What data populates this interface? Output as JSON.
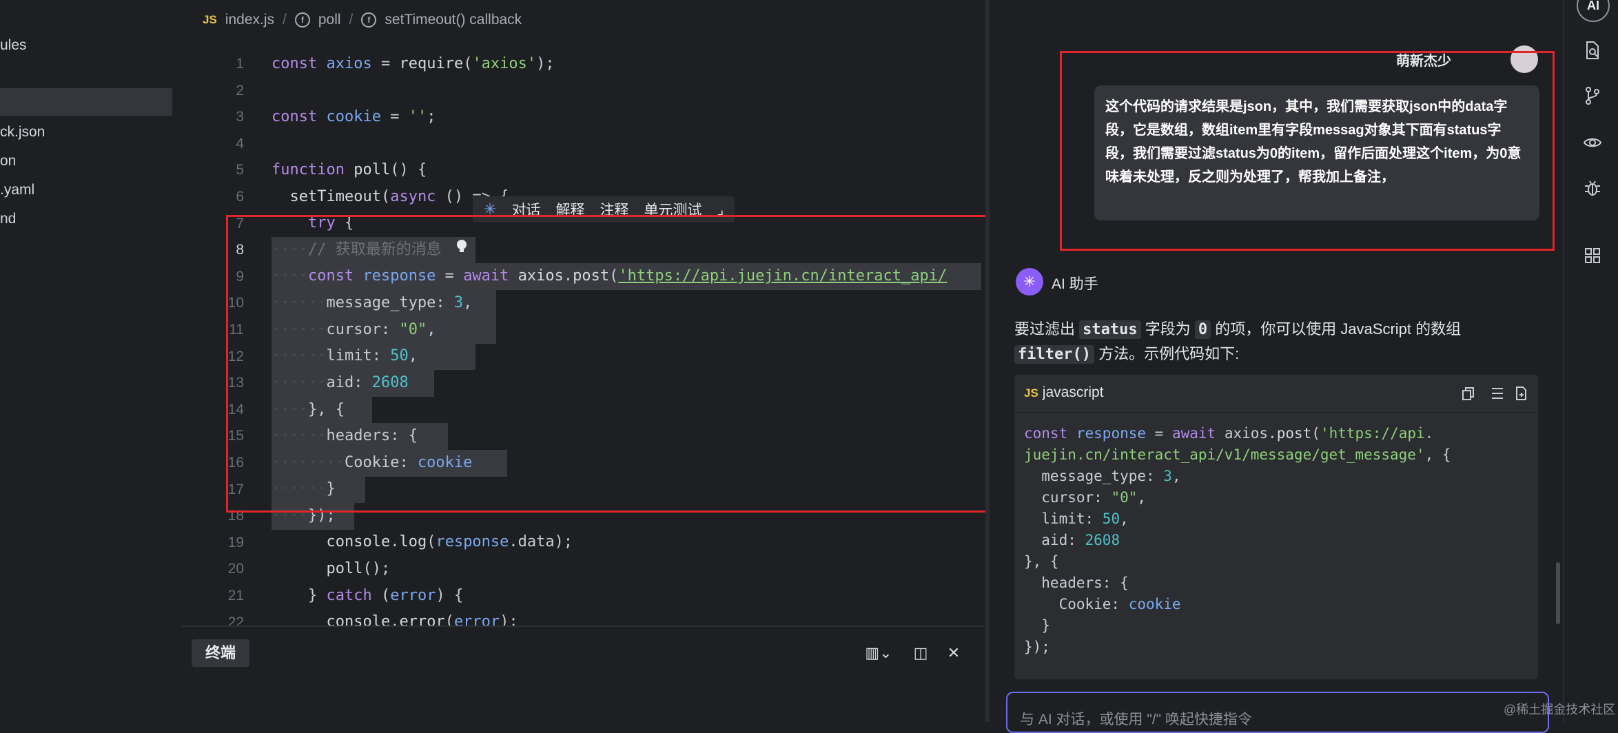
{
  "explorer": {
    "items": [
      "ules",
      "",
      "ck.json",
      "on",
      ".yaml",
      "nd"
    ]
  },
  "editor": {
    "breadcrumb": {
      "file_badge": "JS",
      "file": "index.js",
      "fn1": "poll",
      "fn2": "setTimeout() callback"
    },
    "line_numbers": [
      "1",
      "2",
      "3",
      "4",
      "5",
      "6",
      "7",
      "8",
      "9",
      "10",
      "11",
      "12",
      "13",
      "14",
      "15",
      "16",
      "17",
      "18",
      "19",
      "20",
      "21",
      "22"
    ],
    "inline_menu": [
      "对话",
      "解释",
      "注释",
      "单元测试"
    ],
    "comment": "// 获取最新的消息",
    "url": "'https://api.juejin.cn/interact_api/"
  },
  "terminal": {
    "tab_label": "终端"
  },
  "ai_panel": {
    "user_name": "萌新杰少",
    "user_message": "这个代码的请求结果是json，其中，我们需要获取json中的data字段，它是数组，数组item里有字段messag对象其下面有status字段，我们需要过滤status为0的item，留作后面处理这个item，为0意味着未处理，反之则为处理了，帮我加上备注，",
    "assistant_name": "AI 助手",
    "answer_parts": [
      "要过滤出 ",
      "status",
      " 字段为 ",
      "0",
      " 的项，你可以使用 JavaScript 的数组 ",
      "filter()",
      " 方法。示例代码如下:"
    ],
    "code_lang_badge": "JS",
    "code_lang": "javascript",
    "code_lines": [
      "const response = await axios.post('https://api.",
      "juejin.cn/interact_api/v1/message/get_message', {",
      "  message_type: 3,",
      "  cursor: \"0\",",
      "  limit: 50,",
      "  aid: 2608",
      "}, {",
      "  headers: {",
      "    Cookie: cookie",
      "  }",
      "});"
    ],
    "input_placeholder": "与 AI 对话，或使用 \"/\" 唤起快捷指令"
  },
  "activity_bar": {
    "ai_label": "AI"
  },
  "watermark": "@稀土掘金技术社区",
  "colors": {
    "accent_red": "#e0262c",
    "keyword": "#b38ae8",
    "string": "#8fcf7b",
    "number": "#4fc1c9",
    "variable": "#7aa8ef"
  }
}
